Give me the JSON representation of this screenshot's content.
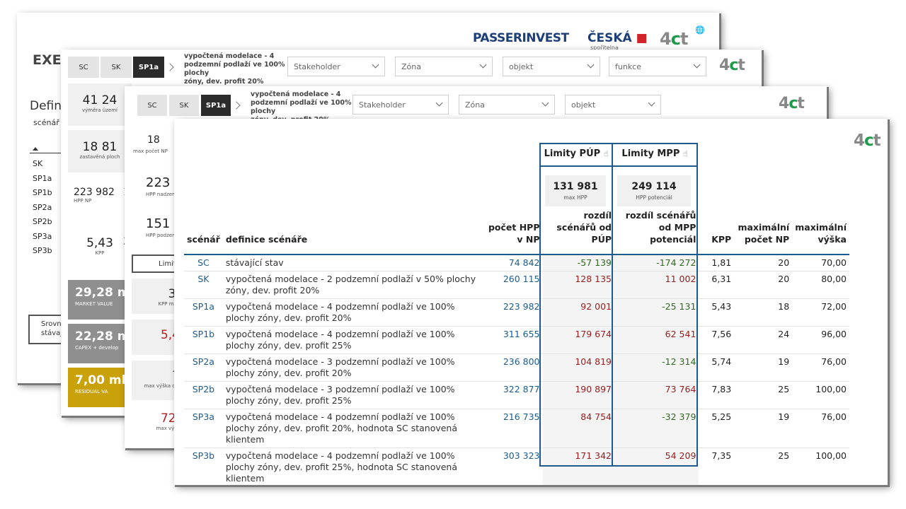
{
  "back_card": {
    "title_partial": "EXEC",
    "section_partial": "Definic",
    "scenario_label": "scénář",
    "scenarios": [
      "SK",
      "SP1a",
      "SP1b",
      "SP2a",
      "SP2b",
      "SP3a",
      "SP3b"
    ],
    "compare_box": [
      "Srovna",
      "stávajíc"
    ],
    "logos": {
      "passerinvest": "PASSERINVEST",
      "ceska": "ČESKÁ",
      "ceska_sub": "spořitelna",
      "fourct": "4ct"
    }
  },
  "card2": {
    "tabs": [
      "SC",
      "SK",
      "SP1a"
    ],
    "active_tab": "SP1a",
    "breadcrumb": [
      "vypočtená modelace - 4",
      "podzemní podlaží ve 100% plochy",
      "zóny, dev. profit 20%"
    ],
    "filters": [
      "Stakeholder",
      "Zóna",
      "objekt",
      "funkce"
    ],
    "kpis": [
      {
        "value": "41 24",
        "label": "výměra území"
      },
      {
        "value": "18 81",
        "label": "zastavěná ploch"
      },
      {
        "value": "223 982",
        "label": "HPP NP",
        "extra": "1"
      },
      {
        "value": "5,43",
        "label": "KPP",
        "extra": "3"
      }
    ],
    "money": [
      {
        "value": "29,28 m",
        "label": "MARKET VALUE"
      },
      {
        "value": "22,28 m",
        "label": "CAPEX + develop"
      },
      {
        "value": "7,00 ml",
        "label": "RESIDUAL VA"
      }
    ],
    "logo": "4ct"
  },
  "card3": {
    "tabs": [
      "SC",
      "SK",
      "SP1a"
    ],
    "active_tab": "SP1a",
    "breadcrumb": [
      "vypočtená modelace - 4",
      "podzemní podlaží ve 100% plochy",
      "zóny, dev. profit 20%"
    ],
    "filters": [
      "Stakeholder",
      "Zóna",
      "objekt"
    ],
    "kpis": [
      {
        "value": "18",
        "label": "max počet NP"
      },
      {
        "value": "223",
        "label": "HPP nadzem"
      },
      {
        "value": "151",
        "label": "HPP podzem"
      }
    ],
    "limity_label": "Limity",
    "right_kpis": [
      {
        "value": "3,",
        "label": "KPP max"
      },
      {
        "value": "5,4",
        "label": "KF"
      },
      {
        "value": "7",
        "label": "max výška dle"
      },
      {
        "value": "72,",
        "label": "max výšk"
      }
    ],
    "logo": "4ct"
  },
  "front": {
    "logo": "4ct",
    "limits": [
      {
        "label": "Limity PÚP",
        "value": "131 981",
        "sublabel": "max HPP"
      },
      {
        "label": "Limity MPP",
        "value": "249 114",
        "sublabel": "HPP potenciál"
      }
    ],
    "columns": [
      "scénář",
      "definice scénáře",
      "počet HPP v NP",
      "rozdíl scénářů od PÚP",
      "rozdíl scénářů od MPP potenciál",
      "KPP",
      "maximální počet NP",
      "maximální výška"
    ],
    "rows": [
      {
        "sc": "SC",
        "def": "stávající stav",
        "hpp": "74 842",
        "pup": "-57 139",
        "mpp": "-174 272",
        "kpp": "1,81",
        "np": "20",
        "vyska": "70,00"
      },
      {
        "sc": "SK",
        "def": "vypočtená modelace - 2 podzemní podlaží v 50% plochy zóny, dev. profit 20%",
        "hpp": "260 115",
        "pup": "128 135",
        "mpp": "11 002",
        "kpp": "6,31",
        "np": "20",
        "vyska": "80,00"
      },
      {
        "sc": "SP1a",
        "def": "vypočtená modelace - 4 podzemní podlaží ve 100% plochy zóny, dev. profit 20%",
        "hpp": "223 982",
        "pup": "92 001",
        "mpp": "-25 131",
        "kpp": "5,43",
        "np": "18",
        "vyska": "72,00"
      },
      {
        "sc": "SP1b",
        "def": "vypočtená modelace - 4 podzemní podlaží ve 100% plochy zóny, dev. profit 25%",
        "hpp": "311 655",
        "pup": "179 674",
        "mpp": "62 541",
        "kpp": "7,56",
        "np": "24",
        "vyska": "96,00"
      },
      {
        "sc": "SP2a",
        "def": "vypočtená modelace - 3 podzemní podlaží ve 100% plochy zóny, dev. profit 20%",
        "hpp": "236 800",
        "pup": "104 819",
        "mpp": "-12 314",
        "kpp": "5,74",
        "np": "19",
        "vyska": "76,00"
      },
      {
        "sc": "SP2b",
        "def": "vypočtená modelace - 3 podzemní podlaží ve 100% plochy zóny, dev. profit 25%",
        "hpp": "322 877",
        "pup": "190 897",
        "mpp": "73 764",
        "kpp": "7,83",
        "np": "25",
        "vyska": "100,00"
      },
      {
        "sc": "SP3a",
        "def": "vypočtená modelace - 4 podzemní podlaží ve 100% plochy zóny, dev. profit 20%, hodnota SC stanovená klientem",
        "hpp": "216 735",
        "pup": "84 754",
        "mpp": "-32 379",
        "kpp": "5,25",
        "np": "19",
        "vyska": "76,00"
      },
      {
        "sc": "SP3b",
        "def": "vypočtená modelace - 4 podzemní podlaží ve 100% plochy zóny, dev. profit 25%, hodnota SC stanovená klientem",
        "hpp": "303 323",
        "pup": "171 342",
        "mpp": "54 209",
        "kpp": "7,35",
        "np": "25",
        "vyska": "100,00"
      }
    ]
  },
  "colors": {
    "accent_blue": "#1e5b8c",
    "positive_red": "#9b1c1c",
    "negative_green": "#2e6b1f",
    "money_gold": "#c9a10a"
  }
}
